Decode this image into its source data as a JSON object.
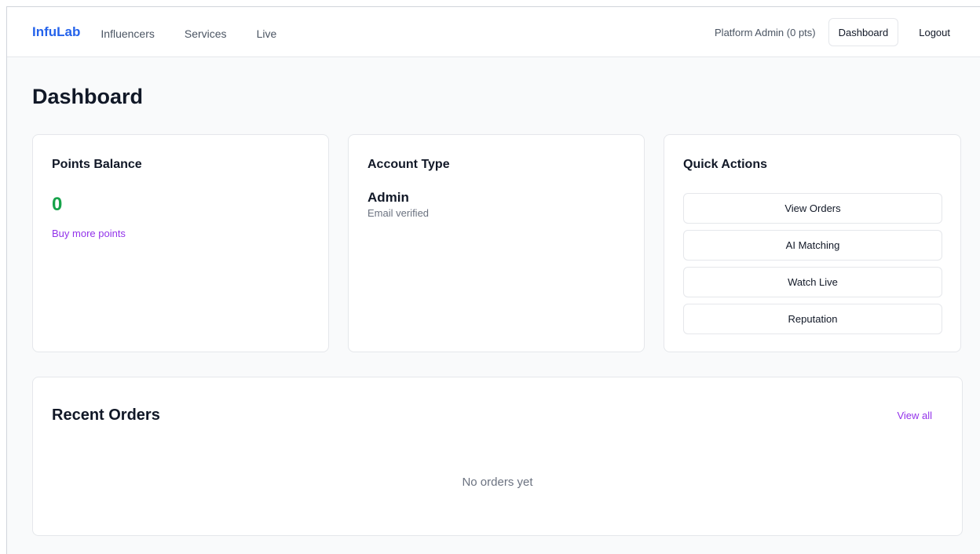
{
  "nav": {
    "brand": "InfuLab",
    "links": [
      "Influencers",
      "Services",
      "Live"
    ],
    "user_label": "Platform Admin (0 pts)",
    "dashboard_label": "Dashboard",
    "logout_label": "Logout"
  },
  "page": {
    "title": "Dashboard"
  },
  "points_card": {
    "title": "Points Balance",
    "value": "0",
    "buy_link": "Buy more points"
  },
  "account_card": {
    "title": "Account Type",
    "role": "Admin",
    "status": "Email verified"
  },
  "quick_actions": {
    "title": "Quick Actions",
    "buttons": [
      "View Orders",
      "AI Matching",
      "Watch Live",
      "Reputation"
    ]
  },
  "orders": {
    "title": "Recent Orders",
    "view_all": "View all",
    "empty": "No orders yet"
  },
  "colors": {
    "brand": "#2563eb",
    "points": "#16a34a",
    "link": "#9333ea",
    "background": "#f9fafb"
  }
}
